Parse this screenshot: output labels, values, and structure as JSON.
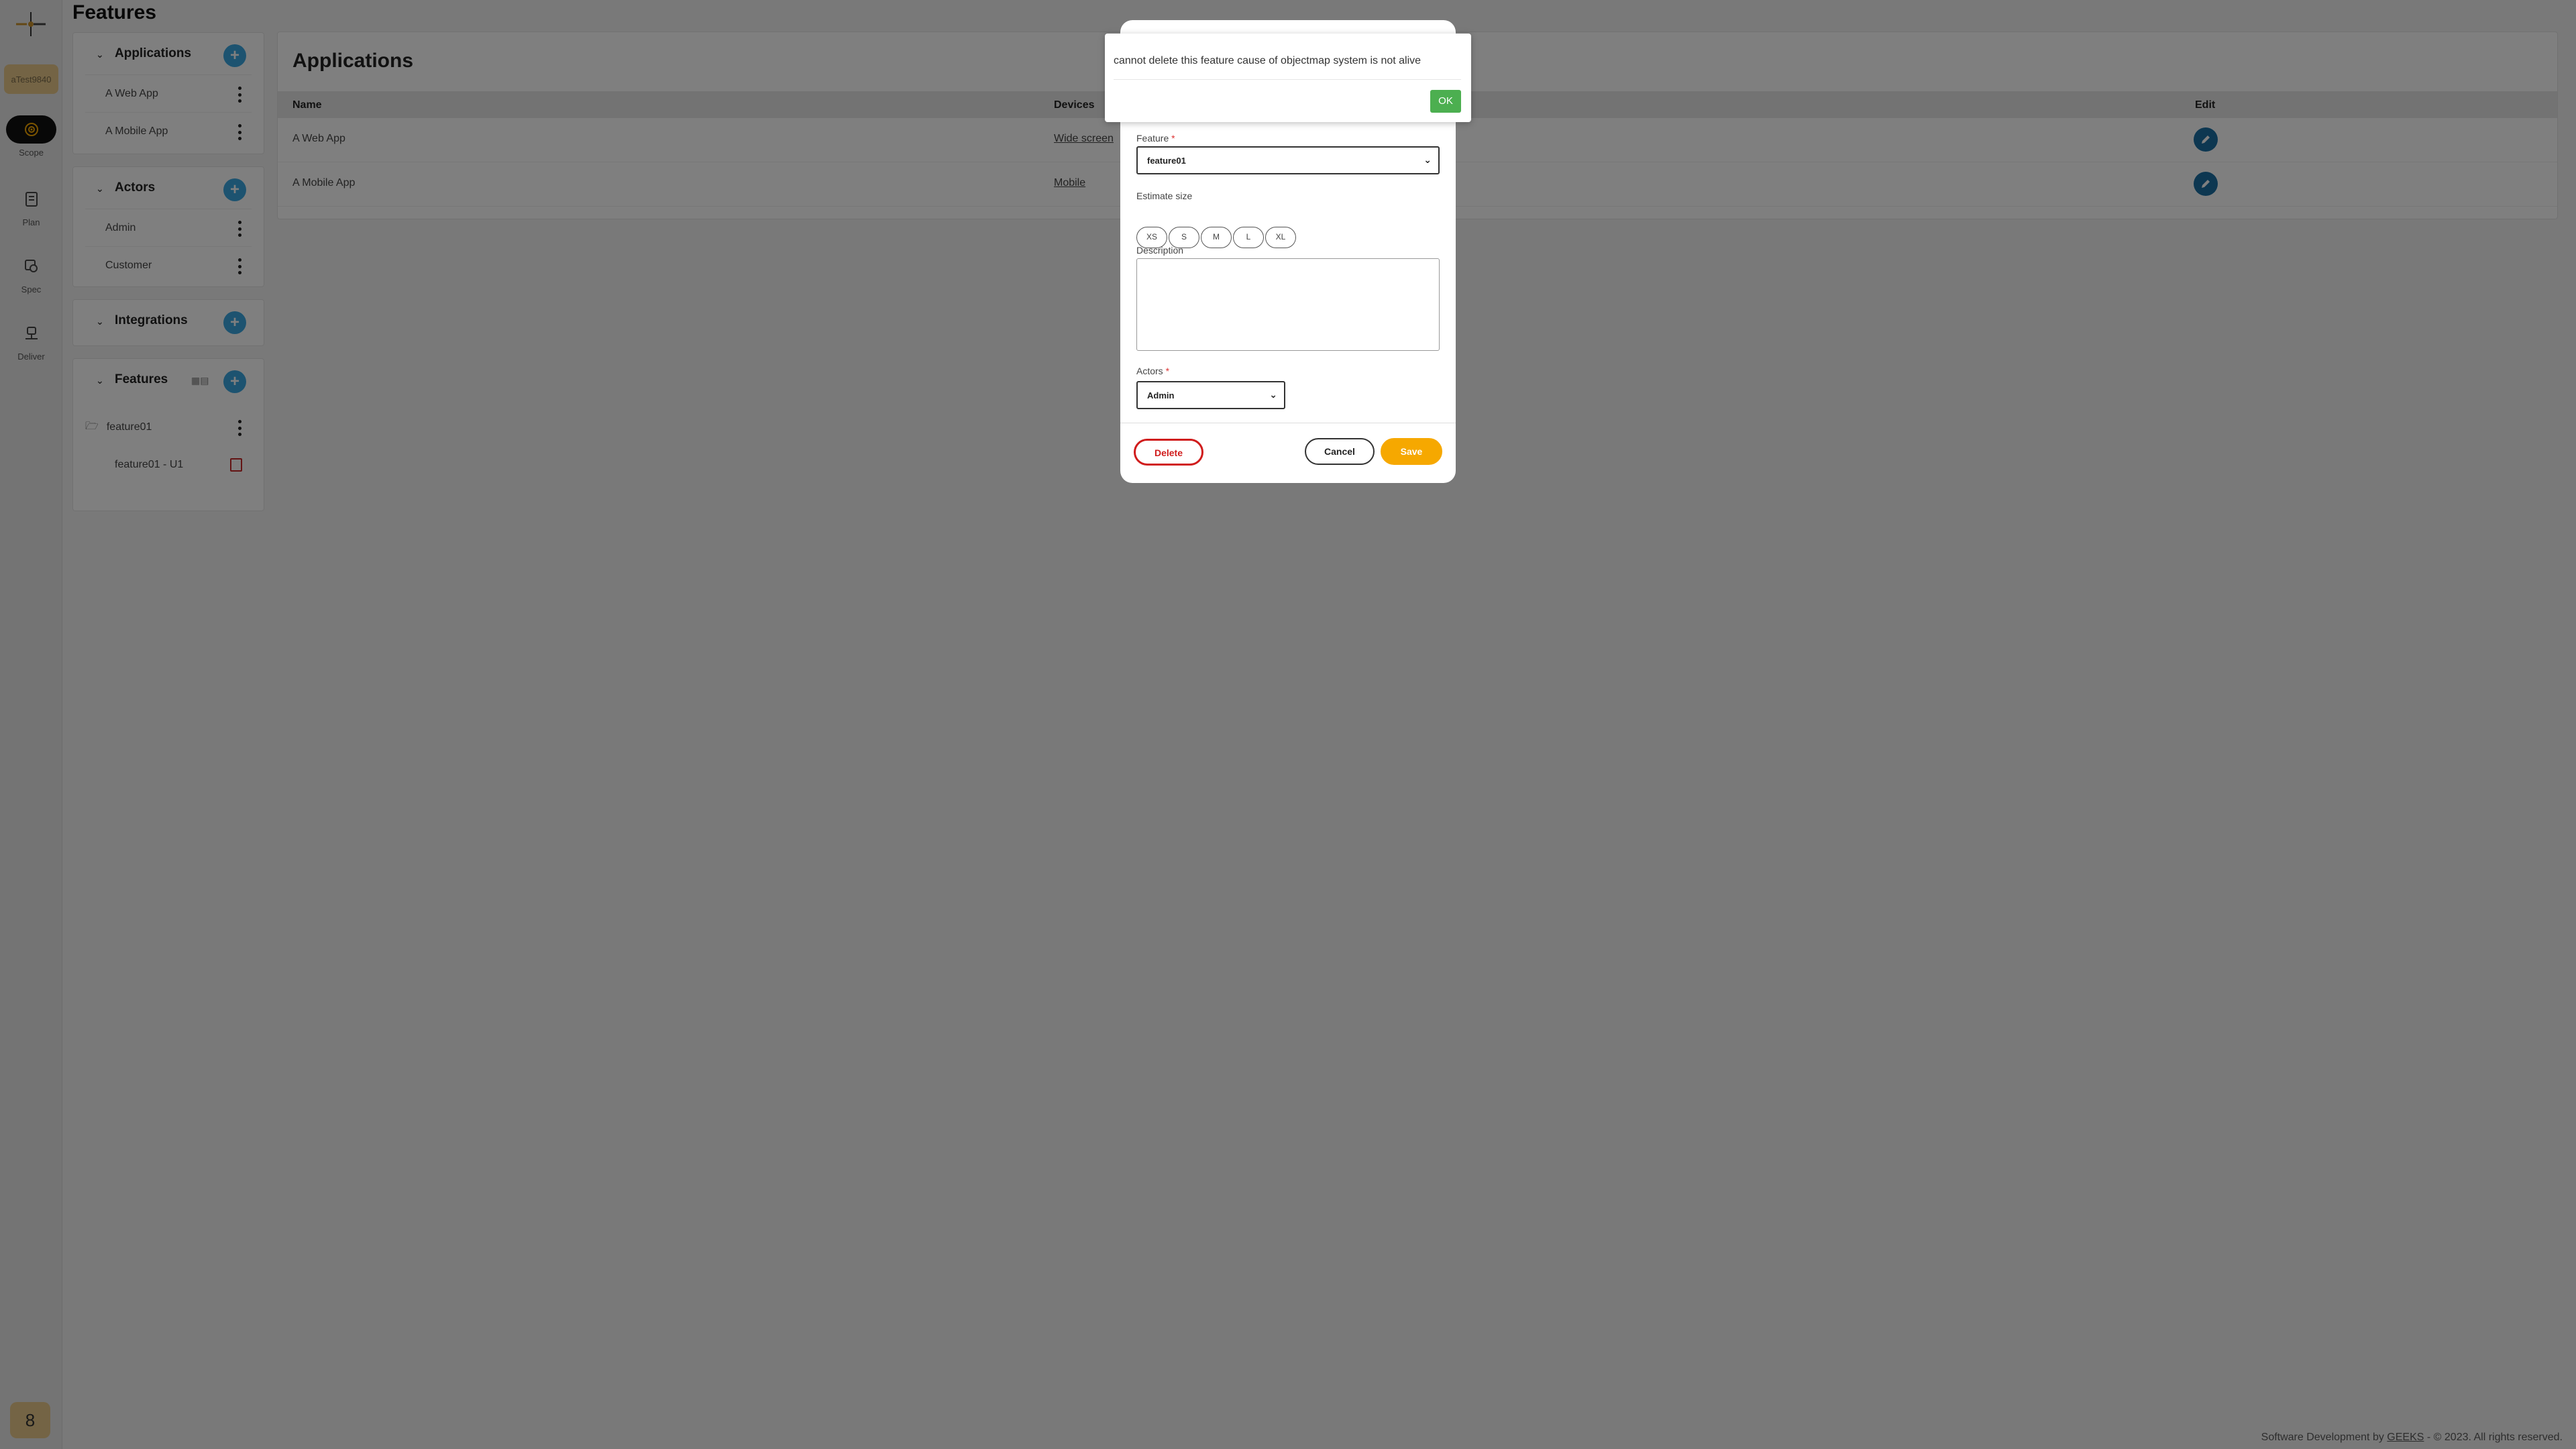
{
  "header": {
    "title": "Features"
  },
  "rail": {
    "user_tag": "aTest9840",
    "nav": [
      {
        "label": "Scope",
        "icon": "target-icon"
      },
      {
        "label": "Plan",
        "icon": "document-icon"
      },
      {
        "label": "Spec",
        "icon": "spec-icon"
      },
      {
        "label": "Deliver",
        "icon": "deliver-icon"
      }
    ],
    "avatar": "8"
  },
  "sidebar": {
    "applications": {
      "title": "Applications",
      "items": [
        "A Web App",
        "A Mobile App"
      ]
    },
    "actors": {
      "title": "Actors",
      "items": [
        "Admin",
        "Customer"
      ]
    },
    "integrations": {
      "title": "Integrations"
    },
    "features": {
      "title": "Features",
      "folder": "feature01",
      "child": "feature01 - U1"
    }
  },
  "main": {
    "title": "Applications",
    "columns": {
      "name": "Name",
      "devices": "Devices",
      "edit": "Edit"
    },
    "rows": [
      {
        "name": "A Web App",
        "device": "Wide screen"
      },
      {
        "name": "A Mobile App",
        "device": "Mobile"
      }
    ]
  },
  "modal": {
    "feature_label": "Feature",
    "feature_value": "feature01",
    "estimate_label": "Estimate size",
    "sizes": [
      "XS",
      "S",
      "M",
      "L",
      "XL"
    ],
    "description_label": "Description",
    "actors_label": "Actors",
    "actors_value": "Admin",
    "required_mark": "*",
    "delete_label": "Delete",
    "cancel_label": "Cancel",
    "save_label": "Save"
  },
  "alert": {
    "message": "cannot delete this feature cause of objectmap system is not alive",
    "ok_label": "OK"
  },
  "footer": {
    "prefix": "Software Development by",
    "link": "GEEKS",
    "suffix": "- © 2023. All rights reserved."
  },
  "colors": {
    "accent_blue": "#3ba6e0",
    "edit_blue": "#1a6fa3",
    "save": "#f6a800",
    "delete": "#d01c1c",
    "ok": "#4caf50",
    "user_tag": "#e8c98a"
  }
}
